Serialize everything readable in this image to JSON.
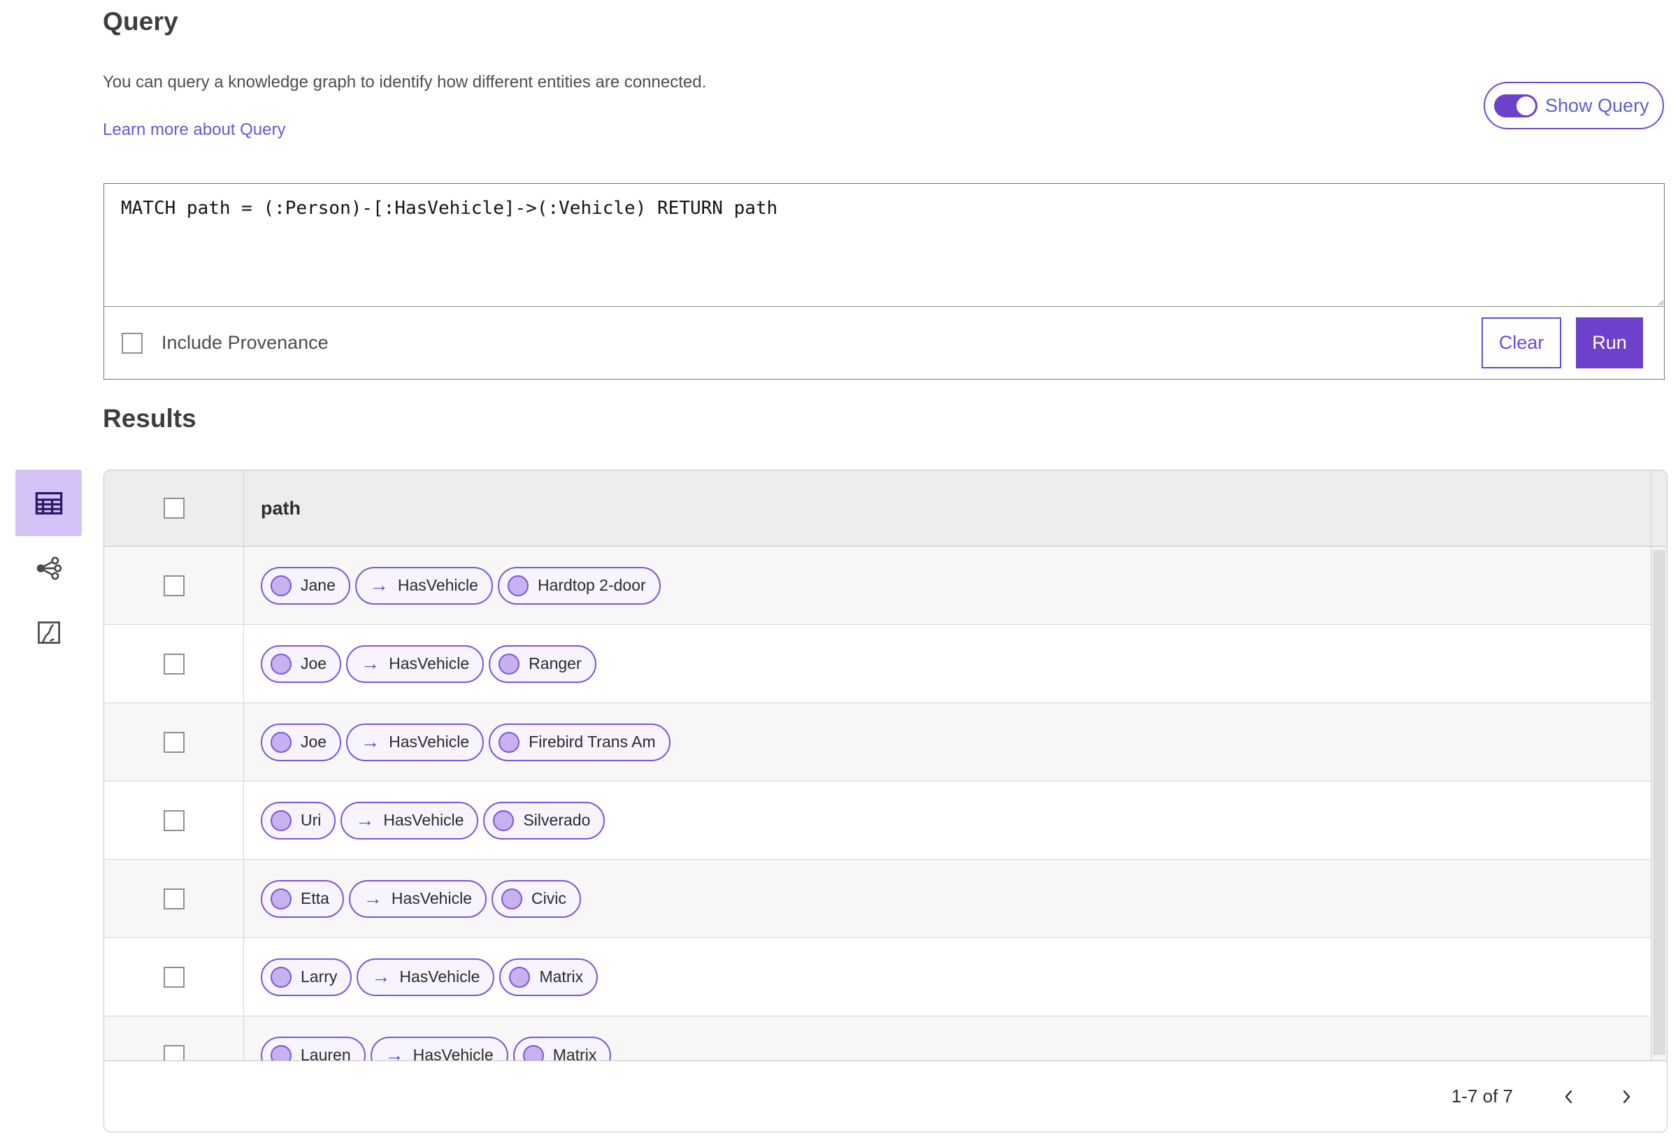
{
  "header": {
    "title": "Query",
    "description": "You can query a knowledge graph to identify how different entities are connected.",
    "learn_more": "Learn more about Query",
    "show_query_label": "Show Query",
    "show_query_enabled": true
  },
  "query_panel": {
    "query_text": "MATCH path = (:Person)-[:HasVehicle]->(:Vehicle) RETURN path",
    "include_provenance_label": "Include Provenance",
    "include_provenance_checked": false,
    "clear_label": "Clear",
    "run_label": "Run"
  },
  "results": {
    "title": "Results",
    "view_switcher": [
      {
        "name": "table-view",
        "icon": "table-icon",
        "selected": true
      },
      {
        "name": "link-chart-view",
        "icon": "link-chart-icon",
        "selected": false
      },
      {
        "name": "map-view",
        "icon": "map-icon",
        "selected": false
      }
    ],
    "table": {
      "column_header": "path",
      "select_all_checked": false,
      "rows": [
        {
          "entity1": "Jane",
          "relationship": "HasVehicle",
          "entity2": "Hardtop 2-door",
          "checked": false
        },
        {
          "entity1": "Joe",
          "relationship": "HasVehicle",
          "entity2": "Ranger",
          "checked": false
        },
        {
          "entity1": "Joe",
          "relationship": "HasVehicle",
          "entity2": "Firebird Trans Am",
          "checked": false
        },
        {
          "entity1": "Uri",
          "relationship": "HasVehicle",
          "entity2": "Silverado",
          "checked": false
        },
        {
          "entity1": "Etta",
          "relationship": "HasVehicle",
          "entity2": "Civic",
          "checked": false
        },
        {
          "entity1": "Larry",
          "relationship": "HasVehicle",
          "entity2": "Matrix",
          "checked": false
        },
        {
          "entity1": "Lauren",
          "relationship": "HasVehicle",
          "entity2": "Matrix",
          "checked": false
        }
      ]
    },
    "pagination": {
      "range_label": "1-7 of 7"
    }
  },
  "icons": {
    "relationship_arrow": "→"
  },
  "colors": {
    "accent_purple": "#6d41cc",
    "accent_outline": "#6d49d4",
    "pill_border": "#7d55da",
    "pill_background": "#f7f4fd",
    "node_fill": "#c7b2ef",
    "selected_view_background": "#d5c3f8",
    "link_text": "#6559d6",
    "header_row_background": "#ededed",
    "alt_row_background": "#f7f7f7"
  }
}
